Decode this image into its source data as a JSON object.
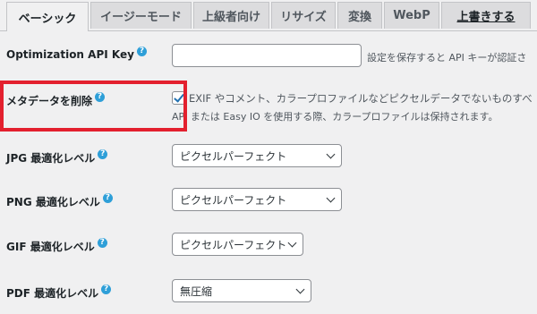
{
  "tabs": [
    {
      "label": "ベーシック",
      "active": true
    },
    {
      "label": "イージーモード"
    },
    {
      "label": "上級者向け"
    },
    {
      "label": "リサイズ"
    },
    {
      "label": "変換"
    },
    {
      "label": "WebP"
    },
    {
      "label": "上書きする",
      "link": true
    }
  ],
  "settings": {
    "api_key": {
      "label": "Optimization API Key",
      "value": "",
      "desc": "設定を保存すると API キーが認証さ"
    },
    "metadata": {
      "label": "メタデータを削除",
      "checked": true,
      "desc_line1": "EXIF やコメント、カラープロファイルなどピクセルデータでないものすべ",
      "desc_line2": "API または Easy IO を使用する際、カラープロファイルは保持されます。"
    },
    "jpg": {
      "label": "JPG 最適化レベル",
      "value": "ピクセルパーフェクト"
    },
    "png": {
      "label": "PNG 最適化レベル",
      "value": "ピクセルパーフェクト"
    },
    "gif": {
      "label": "GIF 最適化レベル",
      "value": "ピクセルパーフェクト"
    },
    "pdf": {
      "label": "PDF 最適化レベル",
      "value": "無圧縮"
    }
  },
  "icons": {
    "help": "?"
  },
  "colors": {
    "highlight": "#e3202e",
    "help_icon": "#2e9fd8",
    "checkmark": "#2271b1"
  }
}
